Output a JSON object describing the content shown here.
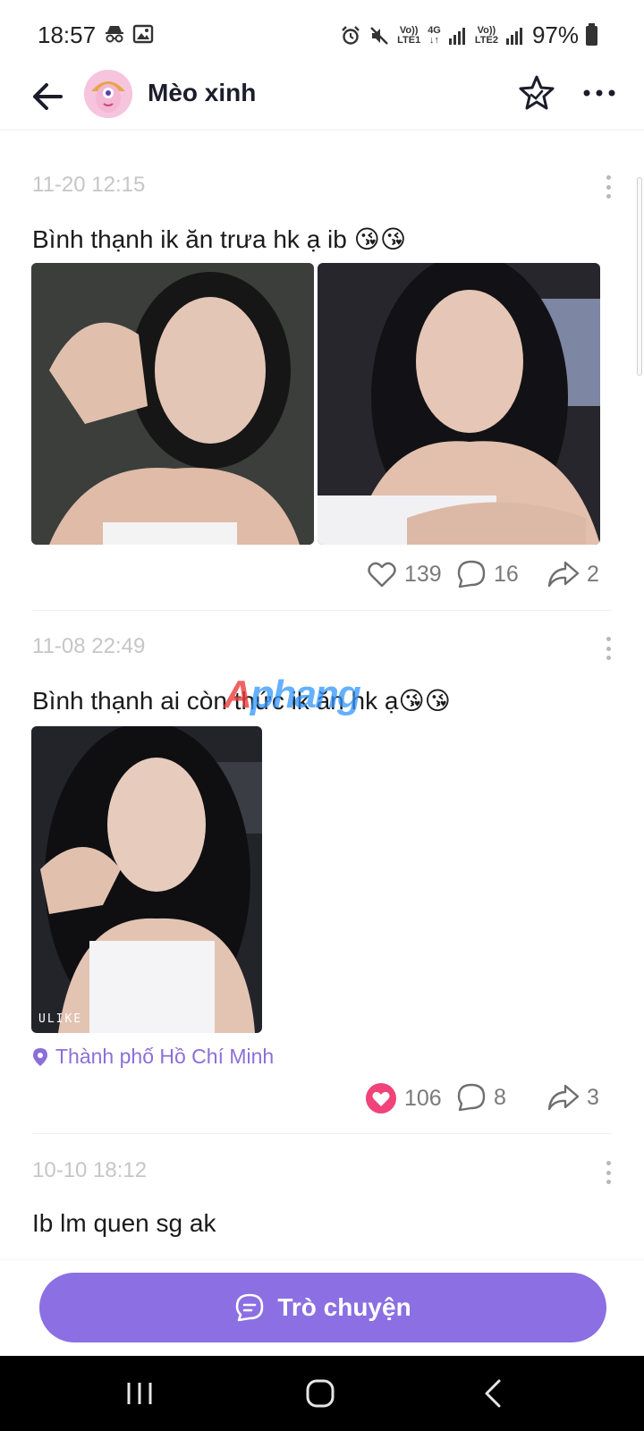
{
  "status_bar": {
    "time": "18:57",
    "sim1_top": "Vo))",
    "sim1_bottom": "LTE1",
    "net_top": "4G",
    "net_bottom": "↓↑",
    "sim2_top": "Vo))",
    "sim2_bottom": "LTE2",
    "battery": "97%"
  },
  "header": {
    "title": "Mèo xinh",
    "icons": [
      "back-arrow-icon",
      "avatar",
      "star-icon",
      "more-dots-icon"
    ]
  },
  "posts": [
    {
      "time": "11-20 12:15",
      "text": "Bình thạnh ik ăn trưa hk ạ ib 😘😘",
      "likes": "139",
      "comments": "16",
      "shares": "2",
      "liked": false
    },
    {
      "time": "11-08 22:49",
      "text": "Bình thạnh ai còn thức ik ăn hk ạ😘😘",
      "photo_label": "ULIKE",
      "location": "Thành phố Hồ Chí Minh",
      "likes": "106",
      "comments": "8",
      "shares": "3",
      "liked": true
    },
    {
      "time": "10-10 18:12",
      "text": "Ib lm quen sg ak"
    }
  ],
  "watermark": {
    "part1": "A",
    "part2": "phang"
  },
  "chat_button": {
    "label": "Trò chuyện"
  },
  "colors": {
    "accent": "#8b6fe3",
    "location": "#8b6fd9",
    "like_active": "#f0437a",
    "time_text": "#c6c6c6"
  }
}
